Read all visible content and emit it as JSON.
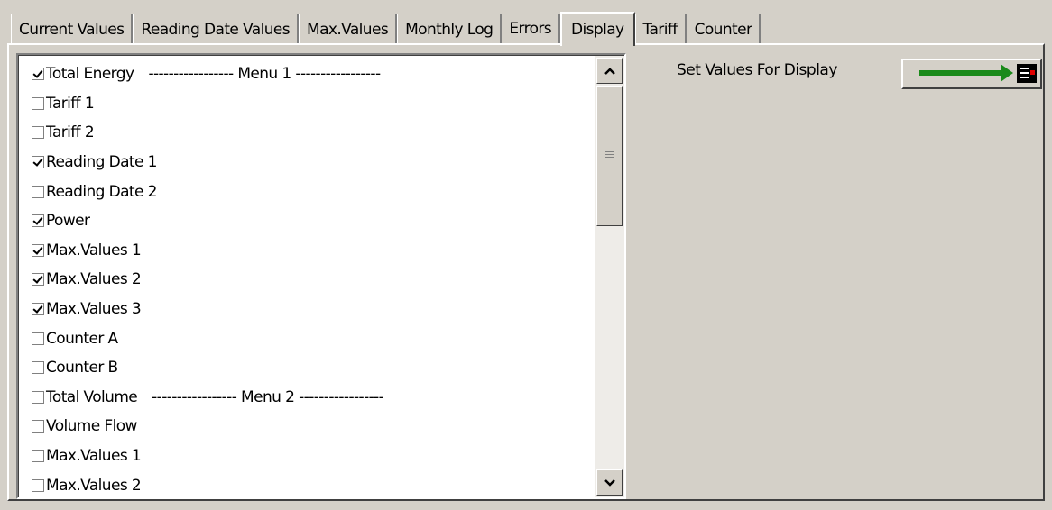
{
  "tabs": [
    {
      "label": "Current Values"
    },
    {
      "label": "Reading Date Values"
    },
    {
      "label": "Max.Values"
    },
    {
      "label": "Monthly Log"
    },
    {
      "label": "Errors"
    },
    {
      "label": "Display"
    },
    {
      "label": "Tariff"
    },
    {
      "label": "Counter"
    }
  ],
  "display_list": {
    "items": [
      {
        "label": "Total Energy",
        "checked": true,
        "menu": "----------------- Menu 1 -----------------"
      },
      {
        "label": "Tariff 1",
        "checked": false
      },
      {
        "label": "Tariff 2",
        "checked": false
      },
      {
        "label": "Reading Date 1",
        "checked": true
      },
      {
        "label": "Reading Date 2",
        "checked": false
      },
      {
        "label": "Power",
        "checked": true
      },
      {
        "label": "Max.Values 1",
        "checked": true
      },
      {
        "label": "Max.Values 2",
        "checked": true
      },
      {
        "label": "Max.Values 3",
        "checked": true
      },
      {
        "label": "Counter A",
        "checked": false
      },
      {
        "label": "Counter B",
        "checked": false
      },
      {
        "label": "Total Volume",
        "checked": false,
        "menu": "----------------- Menu 2 -----------------"
      },
      {
        "label": "Volume Flow",
        "checked": false
      },
      {
        "label": "Max.Values 1",
        "checked": false
      },
      {
        "label": "Max.Values 2",
        "checked": false
      }
    ]
  },
  "set_values": {
    "label": "Set Values For Display",
    "button_icon": "arrow-to-display-icon"
  },
  "colors": {
    "arrow": "#1a8a1a",
    "display_icon_accent": "#e00000"
  }
}
